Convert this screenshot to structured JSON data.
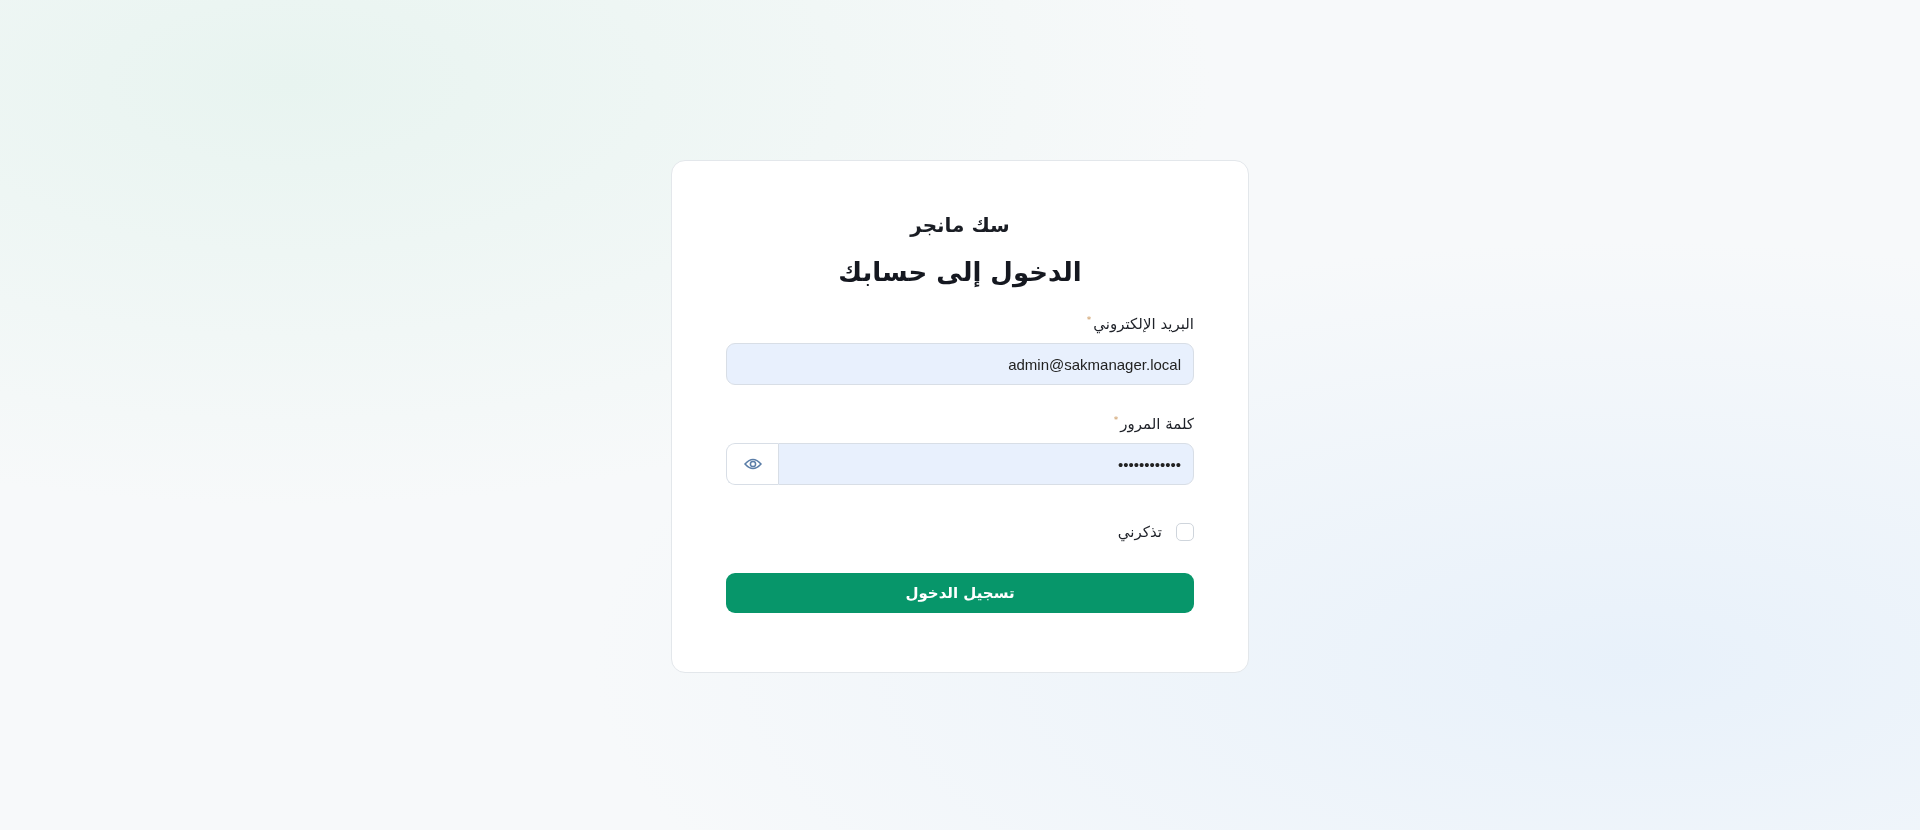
{
  "brand": "سك مانجر",
  "heading": "الدخول إلى حسابك",
  "fields": [
    {
      "kind": "email",
      "label": "البريد الإلكتروني",
      "required_mark": "*",
      "value": "admin@sakmanager.local"
    },
    {
      "kind": "password",
      "label": "كلمة المرور",
      "required_mark": "*",
      "value": "••••••••••••"
    }
  ],
  "remember": {
    "label": "تذكرني",
    "checked": false
  },
  "submit": "تسجيل الدخول"
}
